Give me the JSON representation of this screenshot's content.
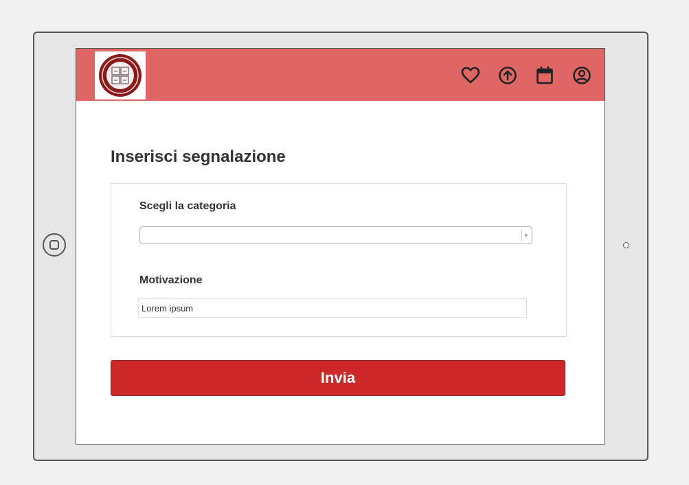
{
  "header": {
    "logo_alt": "university-seal-logo",
    "icons": [
      "heart-icon",
      "upload-icon",
      "calendar-icon",
      "user-icon"
    ]
  },
  "form": {
    "title": "Inserisci segnalazione",
    "category_label": "Scegli la categoria",
    "category_value": "",
    "motivation_label": "Motivazione",
    "motivation_value": "Lorem ipsum",
    "submit_label": "Invia"
  },
  "colors": {
    "header_bg": "#e06666",
    "button_bg": "#cc2828"
  }
}
